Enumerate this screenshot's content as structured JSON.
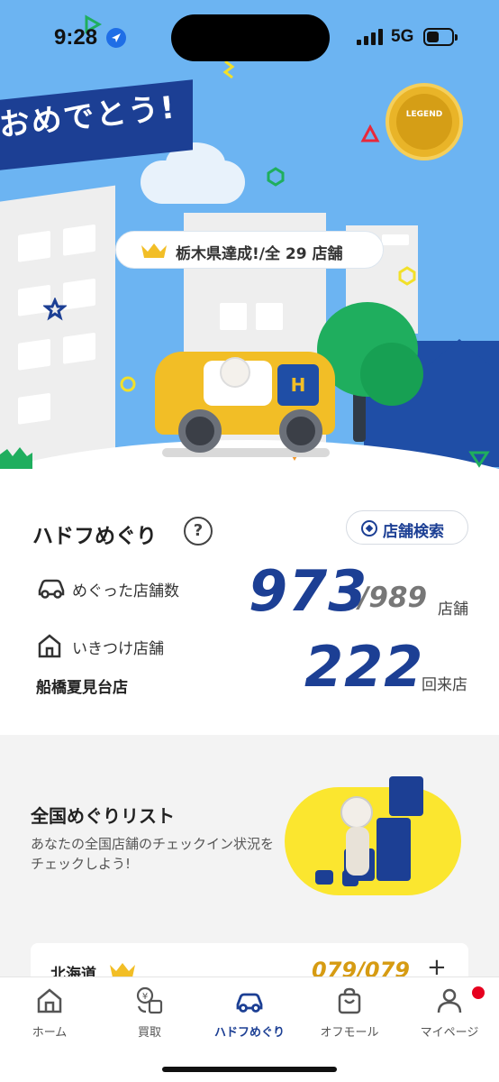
{
  "status_bar": {
    "time": "9:28",
    "network": "5G"
  },
  "hero": {
    "banner_text": "おめでとう!",
    "medal_label": "LEGEND",
    "achievement": {
      "text": "栃木県達成!/全 29 店舗"
    },
    "car_logo": "H"
  },
  "stats": {
    "title": "ハドフめぐり",
    "help": "?",
    "search_button": "店舗検索",
    "visited": {
      "label": "めぐった店舗数",
      "count": "973",
      "total": "/989",
      "unit": "店舗"
    },
    "favorite": {
      "label": "いきつけ店舗",
      "store": "船橋夏見台店",
      "visits": "222",
      "unit": "回来店"
    }
  },
  "list_section": {
    "title": "全国めぐりリスト",
    "description": "あなたの全国店舗のチェックイン状況をチェックしよう!",
    "region": {
      "name": "北海道",
      "count": "079/079",
      "expand": "+"
    }
  },
  "tabbar": {
    "tabs": [
      {
        "label": "ホーム",
        "icon": "home-icon"
      },
      {
        "label": "買取",
        "icon": "buyback-icon"
      },
      {
        "label": "ハドフめぐり",
        "icon": "car-icon",
        "active": true
      },
      {
        "label": "オフモール",
        "icon": "shopping-bag-icon"
      },
      {
        "label": "マイページ",
        "icon": "person-icon"
      }
    ]
  },
  "colors": {
    "primary": "#1c3f94",
    "accent_yellow": "#f2be26",
    "sky": "#6cb4f2",
    "notification": "#e6001f"
  }
}
